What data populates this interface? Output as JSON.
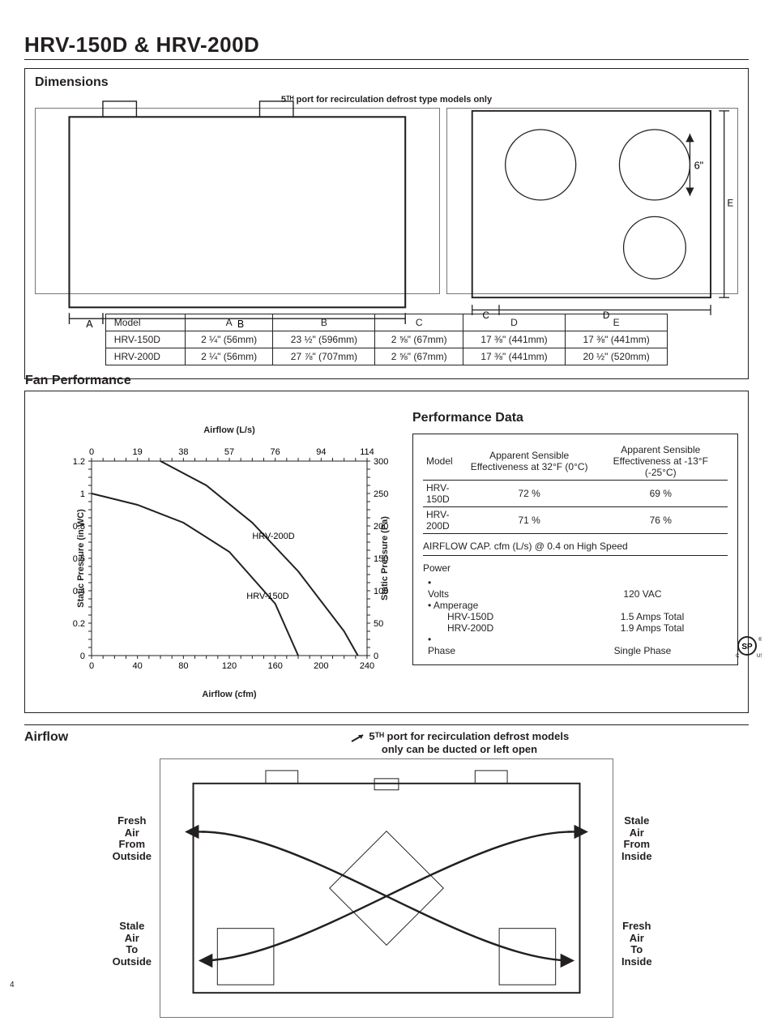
{
  "page_title": "HRV-150D & HRV-200D",
  "page_number": "4",
  "dimensions": {
    "heading": "Dimensions",
    "note": "5ᵀᴴ port for recirculation defrost type models only",
    "side_annotation": "6\"",
    "columns": [
      "Model",
      "A",
      "B",
      "C",
      "D",
      "E"
    ],
    "rows": [
      {
        "model": "HRV-150D",
        "A": "2 ¼\" (56mm)",
        "B": "23 ½\" (596mm)",
        "C": "2 ⅝\" (67mm)",
        "D": "17 ⅜\" (441mm)",
        "E": "17 ⅜\" (441mm)"
      },
      {
        "model": "HRV-200D",
        "A": "2 ¼\" (56mm)",
        "B": "27 ⅞\" (707mm)",
        "C": "2 ⅝\" (67mm)",
        "D": "17 ⅜\" (441mm)",
        "E": "20 ½\" (520mm)"
      }
    ]
  },
  "fan_performance": {
    "heading": "Fan Performance",
    "chart_top_axis_label": "Airflow (L/s)",
    "chart_bottom_axis_label": "Airflow (cfm)",
    "chart_left_axis_label": "Static Pressure (in WC)",
    "chart_right_axis_label": "Static Pressure (Pa)",
    "series_labels": {
      "s1": "HRV-200D",
      "s2": "HRV-150D"
    }
  },
  "chart_data": {
    "type": "line",
    "title": "Fan Performance",
    "x": {
      "label_bottom": "Airflow (cfm)",
      "label_top": "Airflow (L/s)",
      "ticks_bottom": [
        0,
        40,
        80,
        120,
        160,
        200,
        240
      ],
      "ticks_top": [
        0,
        19,
        38,
        57,
        76,
        94,
        114
      ],
      "range": [
        0,
        240
      ]
    },
    "y": {
      "label_left": "Static Pressure (in WC)",
      "label_right": "Static Pressure (Pa)",
      "ticks_left": [
        0,
        0.2,
        0.4,
        0.6,
        0.8,
        1,
        1.2
      ],
      "ticks_right": [
        0,
        50,
        100,
        150,
        200,
        250,
        300
      ],
      "range": [
        0,
        1.2
      ]
    },
    "series": [
      {
        "name": "HRV-150D",
        "points": [
          [
            0,
            1.0
          ],
          [
            40,
            0.93
          ],
          [
            80,
            0.82
          ],
          [
            120,
            0.64
          ],
          [
            160,
            0.32
          ],
          [
            180,
            0.0
          ]
        ]
      },
      {
        "name": "HRV-200D",
        "points": [
          [
            60,
            1.2
          ],
          [
            100,
            1.05
          ],
          [
            140,
            0.82
          ],
          [
            180,
            0.52
          ],
          [
            220,
            0.15
          ],
          [
            232,
            0.0
          ]
        ]
      }
    ],
    "grid": true
  },
  "performance_data": {
    "heading": "Performance Data",
    "col_model": "Model",
    "col_eff32": "Apparent Sensible Effectiveness at 32°F (0°C)",
    "col_eff13": "Apparent Sensible Effectiveness at -13°F (-25°C)",
    "rows": [
      {
        "model": "HRV-150D",
        "eff32": "72 %",
        "eff13": "69 %"
      },
      {
        "model": "HRV-200D",
        "eff32": "71 %",
        "eff13": "76 %"
      }
    ],
    "airflow_cap_note": "AIRFLOW CAP. cfm (L/s) @ 0.4 on High Speed",
    "power_heading": "Power",
    "volts_label": "Volts",
    "volts_value": "120 VAC",
    "amp_label": "Amperage",
    "amp_rows": [
      {
        "model": "HRV-150D",
        "val": "1.5 Amps Total"
      },
      {
        "model": "HRV-200D",
        "val": "1.9 Amps Total"
      }
    ],
    "phase_label": "Phase",
    "phase_value": "Single Phase"
  },
  "airflow": {
    "heading": "Airflow",
    "note_line1": "5ᵀᴴ port for recirculation defrost models",
    "note_line2": "only can be ducted or left open",
    "labels": {
      "fresh_from_outside": "Fresh Air\nFrom Outside",
      "stale_to_outside": "Stale Air\nTo Outside",
      "stale_from_inside": "Stale Air\nFrom Inside",
      "fresh_to_inside": "Fresh Air\nTo Inside"
    }
  }
}
